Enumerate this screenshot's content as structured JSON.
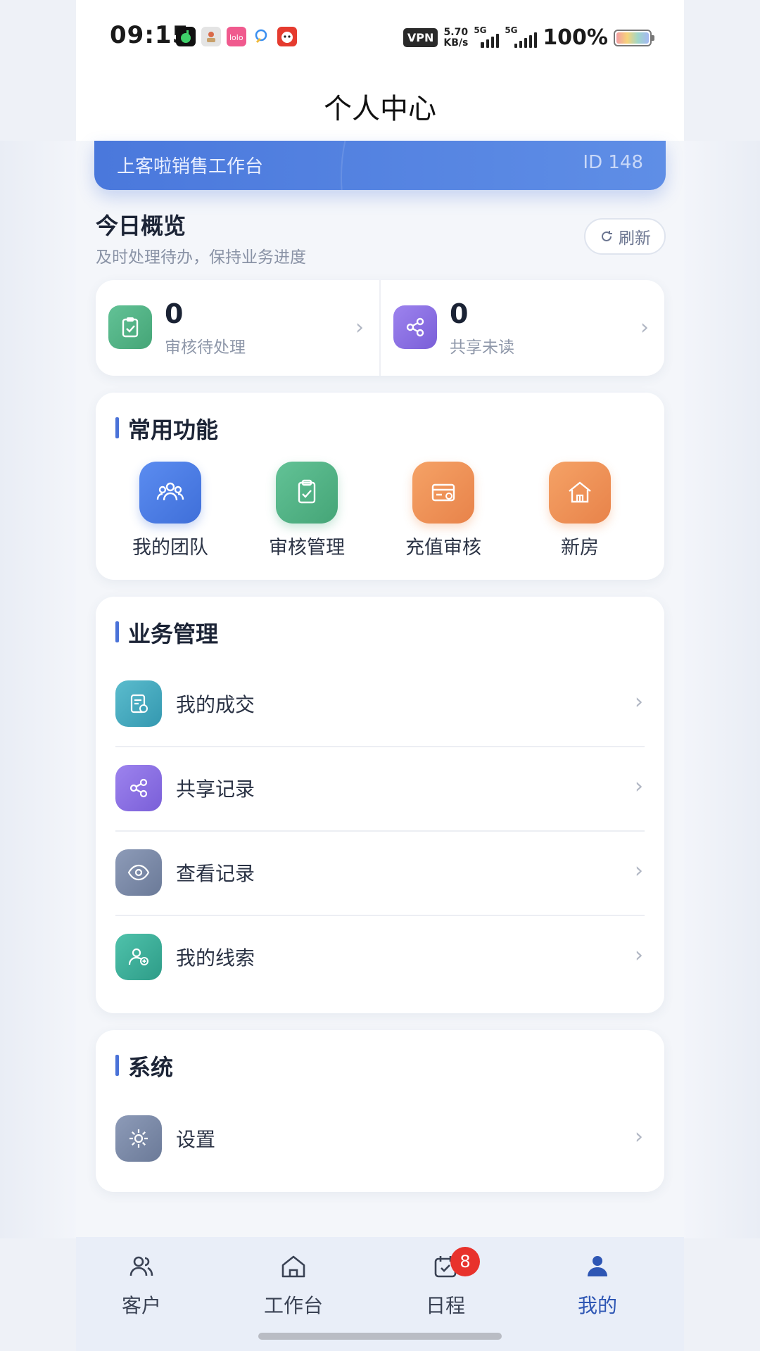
{
  "status_bar": {
    "time": "09:15",
    "vpn": "VPN",
    "net_speed_value": "5.70",
    "net_speed_unit": "KB/s",
    "signal_label": "5G",
    "battery": "100%"
  },
  "header": {
    "title": "个人中心"
  },
  "banner": {
    "name": "上客啦销售工作台",
    "id": "ID 148"
  },
  "overview": {
    "title": "今日概览",
    "subtitle": "及时处理待办，保持业务进度",
    "refresh_label": "刷新",
    "stats": [
      {
        "value": "0",
        "label": "审核待处理",
        "icon": "clipboard-check-icon",
        "color": "#4fb083"
      },
      {
        "value": "0",
        "label": "共享未读",
        "icon": "share-icon",
        "color": "#8a6fe0"
      }
    ]
  },
  "common_functions": {
    "title": "常用功能",
    "items": [
      {
        "label": "我的团队",
        "icon": "team-icon",
        "color": "#4a78dc"
      },
      {
        "label": "审核管理",
        "icon": "clipboard-check-icon",
        "color": "#4fb083"
      },
      {
        "label": "充值审核",
        "icon": "card-icon",
        "color": "#ef8d4e"
      },
      {
        "label": "新房",
        "icon": "house-icon",
        "color": "#ef8d4e"
      }
    ]
  },
  "business": {
    "title": "业务管理",
    "items": [
      {
        "label": "我的成交",
        "icon": "document-icon",
        "color": "#41a9bf"
      },
      {
        "label": "共享记录",
        "icon": "share-icon",
        "color": "#8a6fe0"
      },
      {
        "label": "查看记录",
        "icon": "eye-icon",
        "color": "#7a8aa8"
      },
      {
        "label": "我的线索",
        "icon": "user-add-icon",
        "color": "#3aaf9a"
      }
    ]
  },
  "system": {
    "title": "系统",
    "items": [
      {
        "label": "设置",
        "icon": "gear-icon",
        "color": "#7a8aa8"
      }
    ]
  },
  "tab_bar": {
    "tabs": [
      {
        "label": "客户",
        "icon": "customers-icon"
      },
      {
        "label": "工作台",
        "icon": "home-icon"
      },
      {
        "label": "日程",
        "icon": "calendar-icon",
        "badge": "8"
      },
      {
        "label": "我的",
        "icon": "person-icon",
        "active": true
      }
    ],
    "active_color": "#2e56b4"
  }
}
